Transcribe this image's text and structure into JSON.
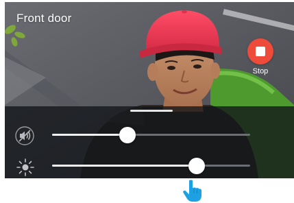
{
  "camera": {
    "title": "Front door"
  },
  "stop_button": {
    "label": "Stop",
    "icon": "stop-square-icon",
    "color": "#ee4b3b"
  },
  "controls": {
    "volume": {
      "icon": "speaker-muted-icon",
      "value": 0.38
    },
    "brightness": {
      "icon": "sun-icon",
      "value": 0.73
    }
  },
  "pointer": {
    "icon": "tap-hand-icon",
    "color": "#1ea1e3"
  }
}
